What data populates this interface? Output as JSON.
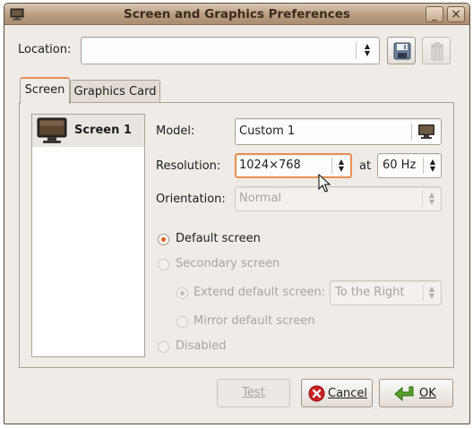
{
  "window": {
    "title": "Screen and Graphics Preferences"
  },
  "titlebar_buttons": {
    "minimize": "_",
    "close": "×"
  },
  "location": {
    "label": "Location:",
    "value": ""
  },
  "tabs": [
    {
      "label": "Screen"
    },
    {
      "label": "Graphics Card"
    }
  ],
  "screens": [
    {
      "label": "Screen 1"
    }
  ],
  "form": {
    "model_label": "Model:",
    "model_value": "Custom 1",
    "resolution_label": "Resolution:",
    "resolution_value": "1024×768",
    "at_label": "at",
    "refresh_value": "60 Hz",
    "orientation_label": "Orientation:",
    "orientation_value": "Normal"
  },
  "options": {
    "default_screen": "Default screen",
    "secondary_screen": "Secondary screen",
    "extend_default": "Extend default screen:",
    "extend_direction": "To the Right",
    "mirror_default": "Mirror default screen",
    "disabled": "Disabled"
  },
  "buttons": {
    "test": "Test",
    "cancel": "Cancel",
    "ok": "OK"
  },
  "colors": {
    "accent": "#e98f52",
    "titlebar": "#b99c7f",
    "window_bg": "#efebe7"
  }
}
